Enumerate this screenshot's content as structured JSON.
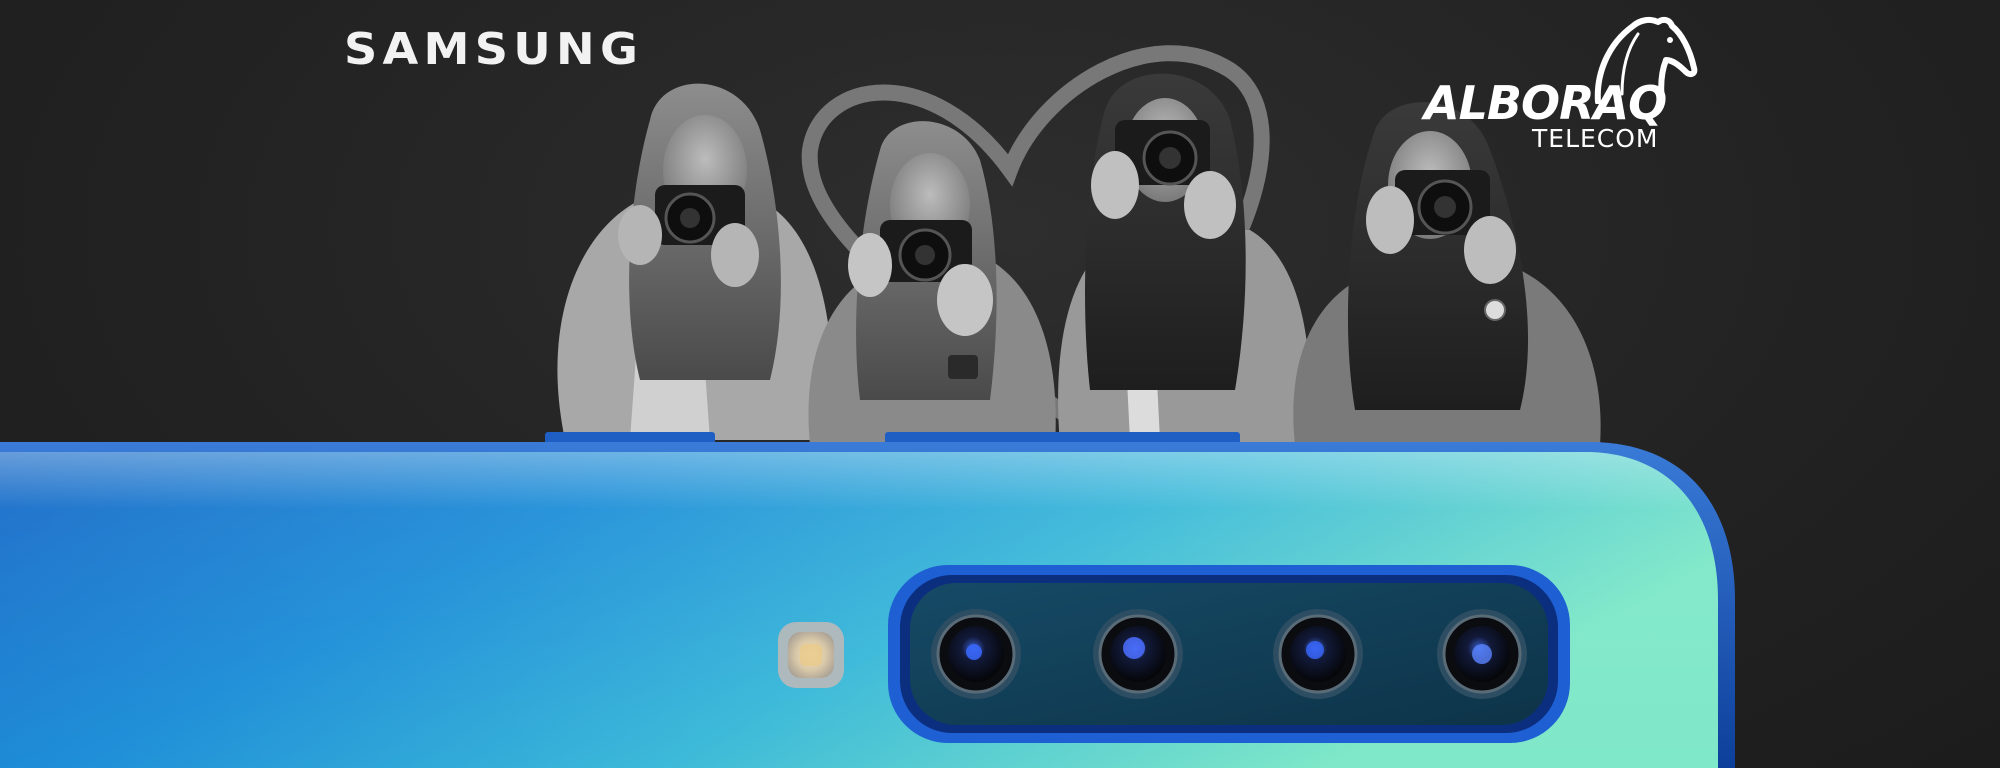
{
  "brand": {
    "samsung": "SAMSUNG",
    "partner_name": "ALBORAQ",
    "partner_sub": "TELECOM"
  },
  "icons": {
    "partner_mark": "horse-head-icon",
    "heart": "heart-outline-icon",
    "flash": "flash-icon",
    "camera_lens": "camera-lens-icon"
  },
  "colors": {
    "background": "#232323",
    "phone_blue": "#1769c9",
    "phone_teal": "#6fe3c7",
    "camera_module": "#123f57"
  }
}
